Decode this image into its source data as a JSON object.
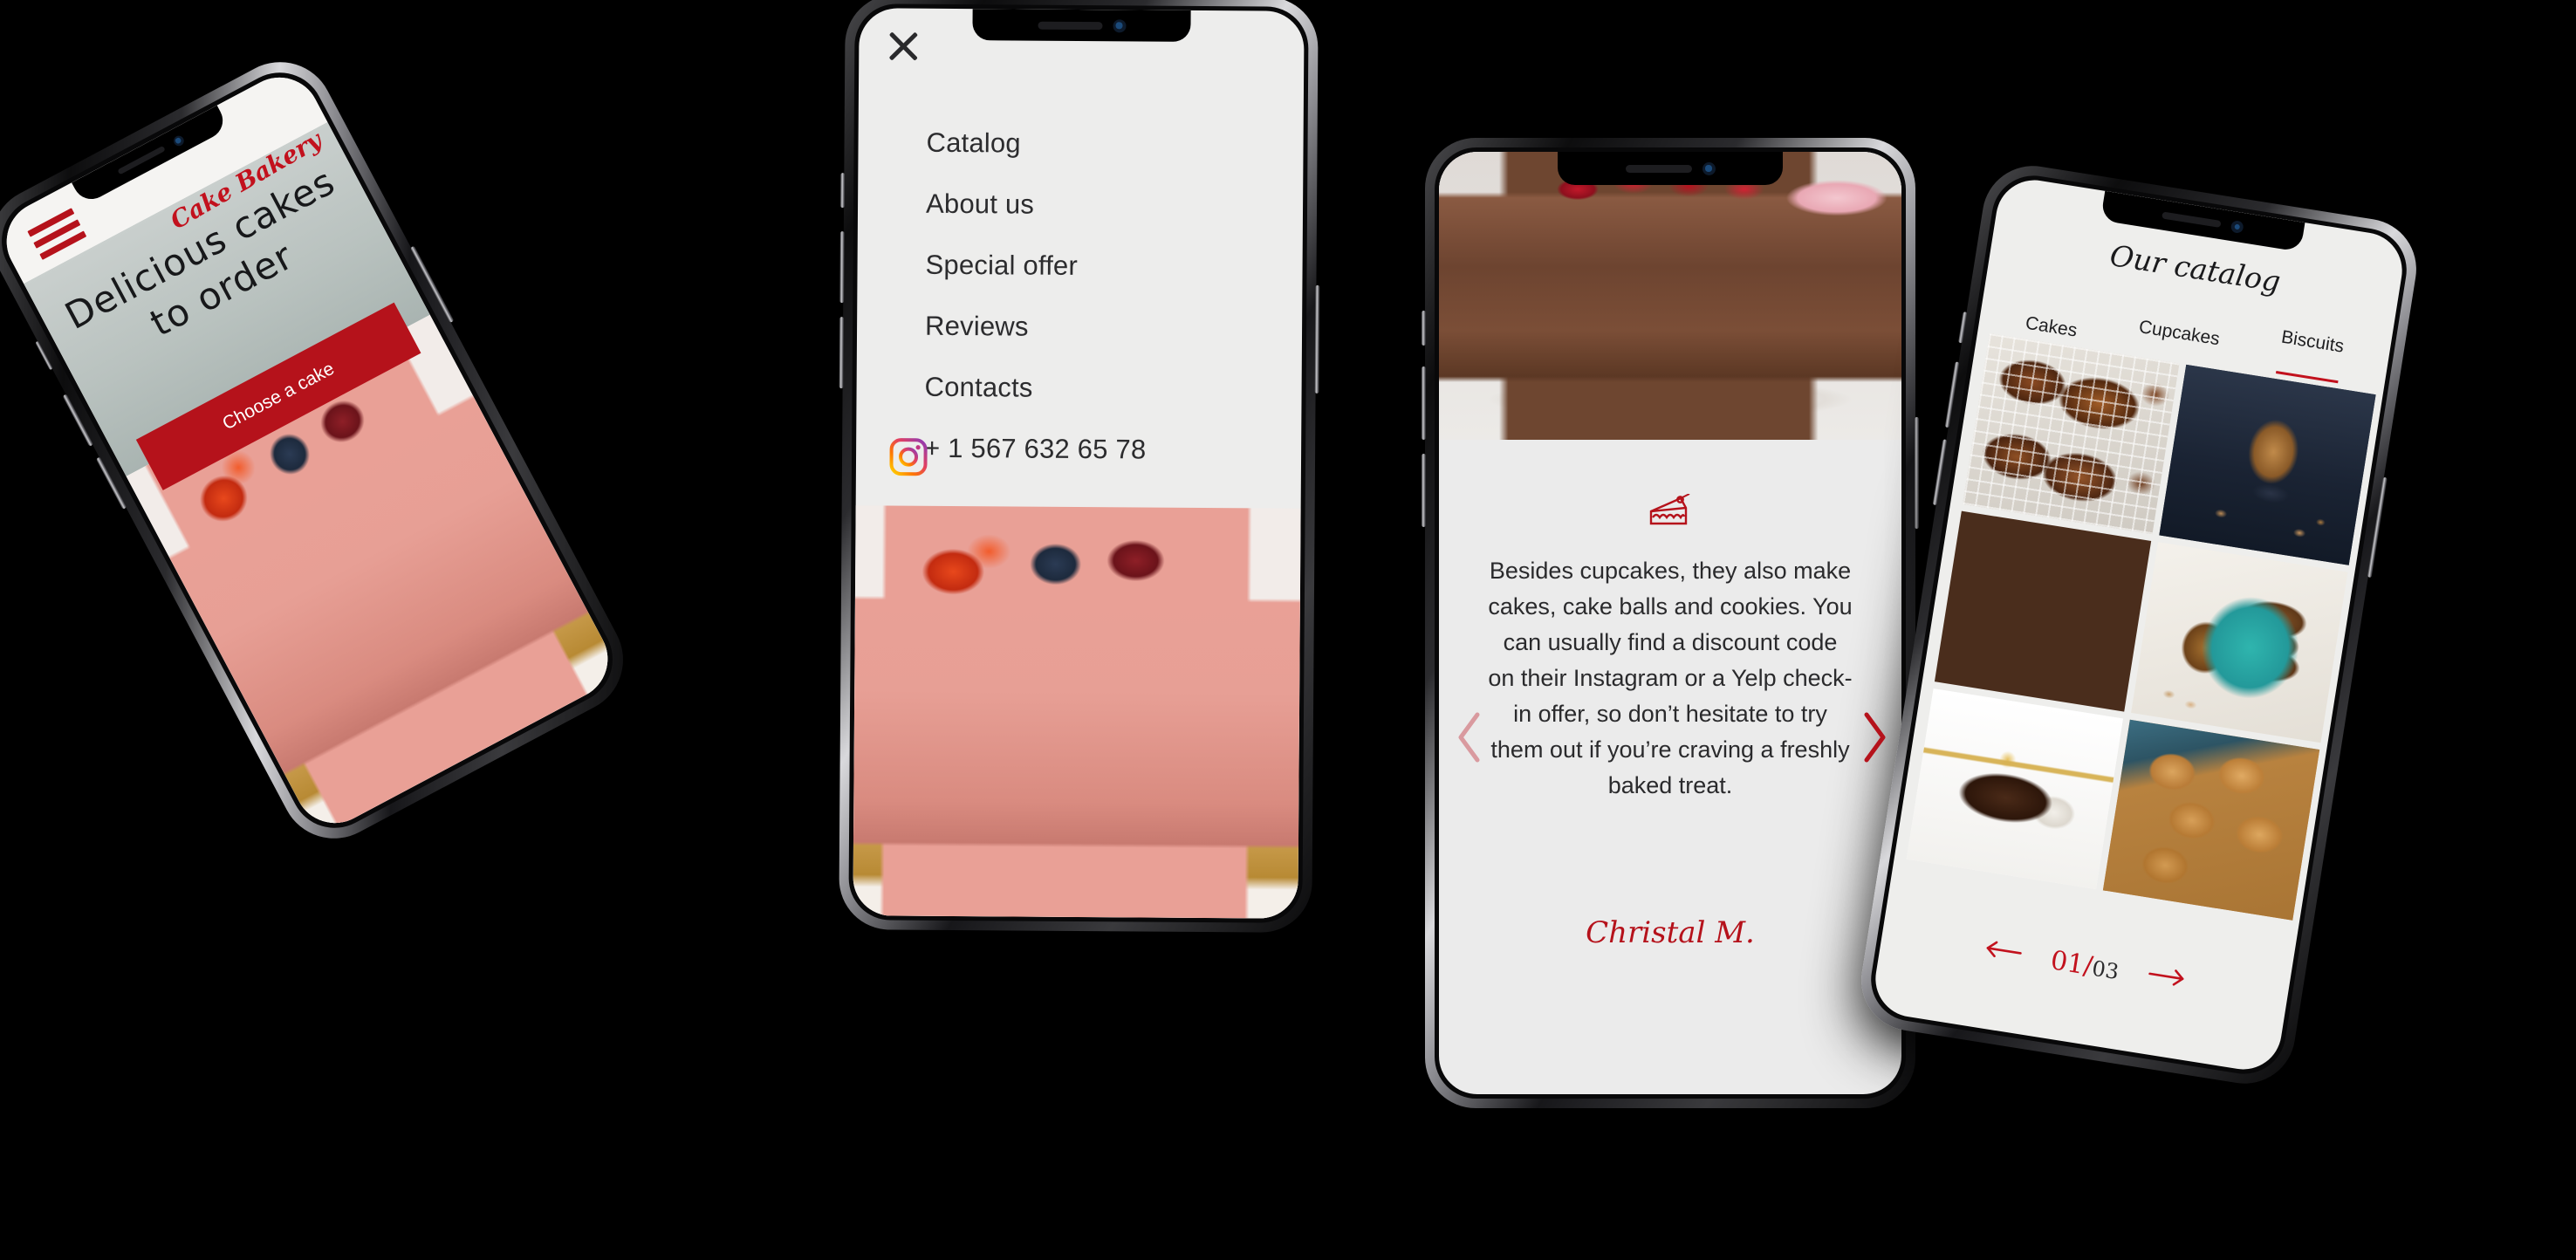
{
  "brand": {
    "name": "Cake Bakery",
    "accent": "#b5121b",
    "accent_dark": "#c2111d",
    "screen_bg": "#ededec"
  },
  "phone1": {
    "menu_icon": "hamburger-icon",
    "logo": "Cake Bakery",
    "headline_line1": "Delicious cakes",
    "headline_line2": "to order",
    "cta_label": "Choose a cake",
    "hero_photo": "pink-mousse-cake-with-berries"
  },
  "phone2": {
    "close_icon": "close-icon",
    "menu_items": [
      "Catalog",
      "About us",
      "Special offer",
      "Reviews",
      "Contacts"
    ],
    "phone_number": "+ 1 567 632 65 78",
    "social_icon": "instagram-icon",
    "photo": "pink-mousse-cake-with-berries"
  },
  "phone3": {
    "hero_photo": "chocolate-cake-with-raspberries",
    "icon": "cake-slice-icon",
    "review_text": "Besides cupcakes, they also make cakes, cake balls and cookies. You can usually find a discount code on their Instagram or a Yelp check-in offer, so don’t hesitate to try them out if you’re craving a freshly baked treat.",
    "review_author": "Christal M.",
    "prev_icon": "chevron-left-icon",
    "next_icon": "chevron-right-icon"
  },
  "phone4": {
    "title": "Our catalog",
    "tabs": [
      {
        "label": "Cakes",
        "active": false
      },
      {
        "label": "Cupcakes",
        "active": false
      },
      {
        "label": "Biscuits",
        "active": true
      }
    ],
    "gallery": [
      "swirl-brownies-on-cooling-rack",
      "crumbly-biscuit-stack-dark-background",
      "chocolate-brownies-with-yellow-flowers",
      "chocolate-cookies-on-teal-plate",
      "brownie-bar-with-gold-ribbon",
      "chocolate-chip-cookies-tray"
    ],
    "pager": {
      "current": "01",
      "separator": "/",
      "total": "03",
      "prev_icon": "arrow-left-icon",
      "next_icon": "arrow-right-icon"
    }
  }
}
